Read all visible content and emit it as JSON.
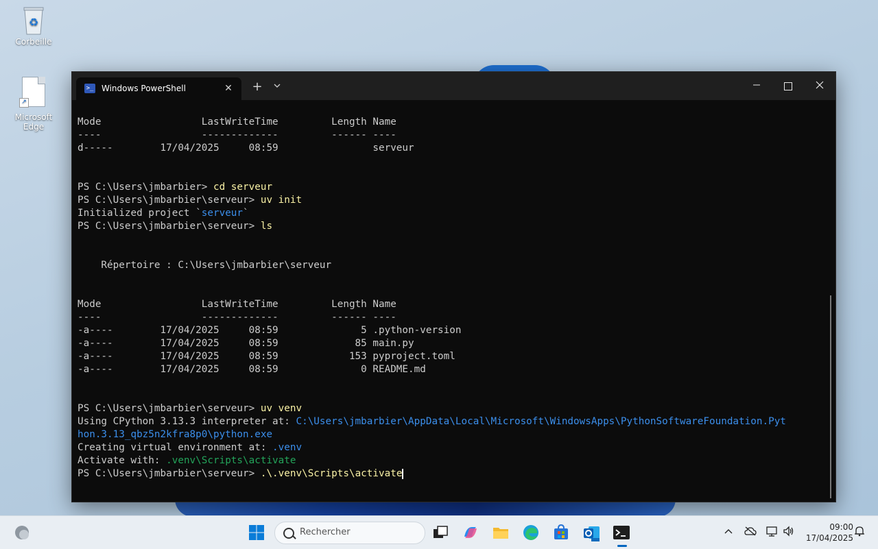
{
  "desktop": {
    "icons": [
      {
        "label": "Corbeille",
        "icon": "recycle-bin-icon"
      },
      {
        "label": "Microsoft Edge",
        "icon": "file-shortcut-icon"
      }
    ]
  },
  "window": {
    "tab_title": "Windows PowerShell",
    "tab_close": "✕",
    "new_tab": "+",
    "dropdown": "⌄",
    "minimize": "—",
    "close": "✕"
  },
  "terminal": {
    "lines": [
      "",
      "Mode                 LastWriteTime         Length Name",
      "----                 -------------         ------ ----",
      "d-----        17/04/2025     08:59                serveur",
      "",
      "",
      "PS C:\\Users\\jmbarbier> ",
      "cd serveur",
      "PS C:\\Users\\jmbarbier\\serveur> ",
      "uv init",
      "Initialized project `",
      "serveur",
      "`",
      "PS C:\\Users\\jmbarbier\\serveur> ",
      "ls",
      "",
      "",
      "    Répertoire : C:\\Users\\jmbarbier\\serveur",
      "",
      "",
      "Mode                 LastWriteTime         Length Name",
      "----                 -------------         ------ ----",
      "-a----        17/04/2025     08:59              5 .python-version",
      "-a----        17/04/2025     08:59             85 main.py",
      "-a----        17/04/2025     08:59            153 pyproject.toml",
      "-a----        17/04/2025     08:59              0 README.md",
      "",
      "",
      "PS C:\\Users\\jmbarbier\\serveur> ",
      "uv venv",
      "Using CPython 3.13.3 interpreter at: ",
      "C:\\Users\\jmbarbier\\AppData\\Local\\Microsoft\\WindowsApps\\PythonSoftwareFoundation.Pyt",
      "hon.3.13_qbz5n2kfra8p0\\python.exe",
      "Creating virtual environment at: ",
      ".venv",
      "Activate with: ",
      ".venv\\Scripts\\activate",
      "PS C:\\Users\\jmbarbier\\serveur> ",
      ".\\.venv\\Scripts\\activate"
    ],
    "colors": {
      "text": "#cccccc",
      "command": "#f9f1a5",
      "path": "#3b8eea",
      "green": "#23a35a"
    }
  },
  "taskbar": {
    "search_placeholder": "Rechercher",
    "time": "09:00",
    "date": "17/04/2025",
    "apps": [
      "widgets-icon",
      "start-icon",
      "search-icon",
      "task-view-icon",
      "copilot-icon",
      "file-explorer-icon",
      "edge-icon",
      "store-icon",
      "outlook-icon",
      "terminal-icon"
    ],
    "tray": [
      "chevron-up-icon",
      "onedrive-icon",
      "network-icon",
      "volume-icon",
      "notification-icon"
    ]
  }
}
